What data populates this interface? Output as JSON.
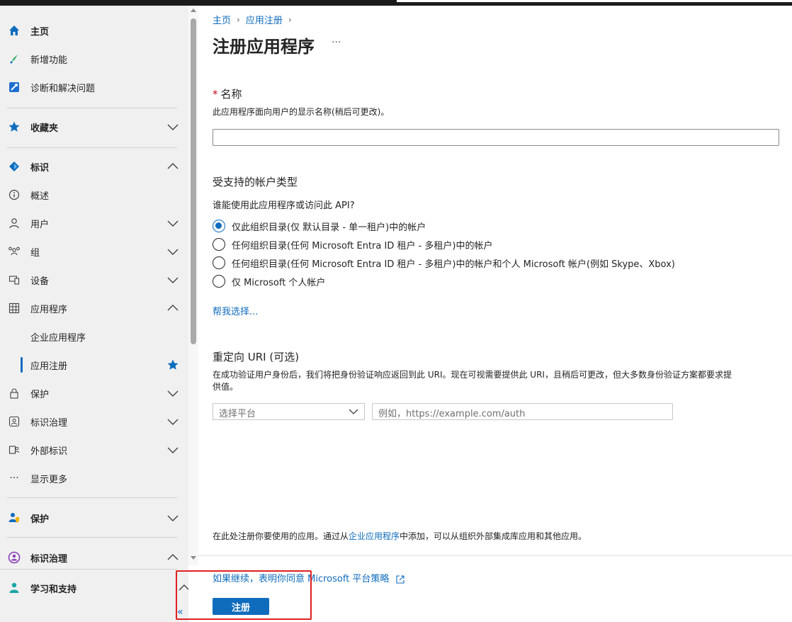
{
  "sidebar": {
    "items": [
      {
        "label": "主页",
        "icon": "home-icon",
        "bold": true
      },
      {
        "label": "新增功能",
        "icon": "rocket-icon"
      },
      {
        "label": "诊断和解决问题",
        "icon": "wrench-icon"
      },
      {
        "label": "收藏夹",
        "icon": "star-icon",
        "bold": true
      },
      {
        "label": "标识",
        "icon": "identity-diamond-icon",
        "bold": true
      },
      {
        "label": "概述",
        "icon": "info-icon"
      },
      {
        "label": "用户",
        "icon": "user-icon"
      },
      {
        "label": "组",
        "icon": "group-icon"
      },
      {
        "label": "设备",
        "icon": "device-icon"
      },
      {
        "label": "应用程序",
        "icon": "apps-grid-icon"
      },
      {
        "label": "企业应用程序"
      },
      {
        "label": "应用注册",
        "selected": true
      },
      {
        "label": "保护",
        "icon": "lock-icon"
      },
      {
        "label": "标识治理",
        "icon": "governance-icon"
      },
      {
        "label": "外部标识",
        "icon": "external-id-icon"
      },
      {
        "label": "显示更多",
        "icon": "more-dots-icon"
      },
      {
        "label": "保护",
        "icon": "shield-user-icon",
        "bold": true
      },
      {
        "label": "标识治理",
        "icon": "governance-color-icon",
        "bold": true
      },
      {
        "label": "学习和支持",
        "icon": "support-user-icon",
        "bold": true
      }
    ],
    "collapse_label": "«"
  },
  "breadcrumb": {
    "home": "主页",
    "app_reg": "应用注册"
  },
  "page": {
    "title": "注册应用程序",
    "more": "···"
  },
  "name_section": {
    "required_mark": "*",
    "title": "名称",
    "description": "此应用程序面向用户的显示名称(稍后可更改)。",
    "value": ""
  },
  "account_section": {
    "title": "受支持的帐户类型",
    "question": "谁能使用此应用程序或访问此 API?",
    "options": [
      "仅此组织目录(仅 默认目录 - 单一租户)中的帐户",
      "任何组织目录(任何 Microsoft Entra ID 租户 - 多租户)中的帐户",
      "任何组织目录(任何 Microsoft Entra ID 租户 - 多租户)中的帐户和个人 Microsoft 帐户(例如 Skype、Xbox)",
      "仅 Microsoft 个人帐户"
    ],
    "selected_index": 0,
    "help_link": "帮我选择..."
  },
  "redirect_section": {
    "title": "重定向 URI (可选)",
    "description_line1": "在成功验证用户身份后，我们将把身份验证响应返回到此 URI。现在可视需要提供此 URI，且稍后可更改，但大多数身份验证方案都要求提",
    "description_line2": "供值。",
    "platform_select": "选择平台",
    "uri_placeholder": "例如，https://example.com/auth"
  },
  "footer": {
    "note_prefix": "在此处注册你要使用的应用。通过从",
    "note_link": "企业应用程序",
    "note_suffix": "中添加，可以从组织外部集成库应用和其他应用。",
    "policy_link": "如果继续，表明你同意 Microsoft 平台策略",
    "register_label": "注册"
  },
  "colors": {
    "accent": "#0f6cbd",
    "highlight": "#e02020",
    "sidebar_bg": "#f0f0f0"
  }
}
